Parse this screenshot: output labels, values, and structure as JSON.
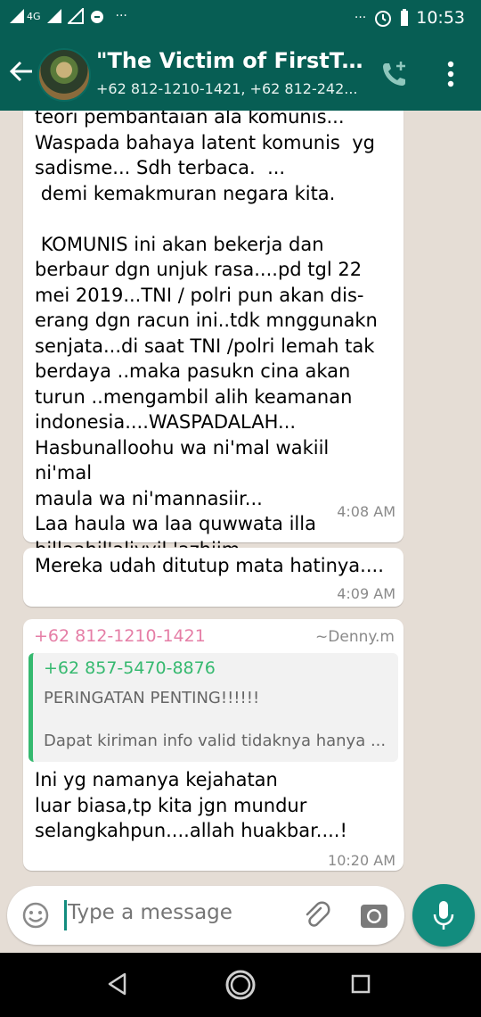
{
  "status_bar": {
    "time": "10:53",
    "more_left": "···",
    "more_right": "···",
    "network_label": "4G"
  },
  "header": {
    "title": "\"The Victim of FirstTrvel",
    "subtitle": "+62 812-1210-1421, +62 812-242..."
  },
  "messages": [
    {
      "text": "teori pembantaian ala komunis...\nWaspada bahaya latent komunis  yg\nsadisme... Sdh terbaca.  ...\n demi kemakmuran negara kita.\n\n KOMUNIS ini akan bekerja dan\nberbaur dgn unjuk rasa....pd tgl 22\nmei 2019...TNI / polri pun akan dis-\nerang dgn racun ini..tdk mnggunakn\nsenjata...di saat TNI /polri lemah tak\nberdaya ..maka pasukn cina akan\nturun ..mengambil alih keamanan\nindonesia....WASPADALAH...\nHasbunalloohu wa ni'mal wakiil ni'mal\nmaula wa ni'mannasiir...\nLaa haula wa laa quwwata illa\nbillaahil'aliyyil 'azhiim...",
      "time": "4:08 AM"
    },
    {
      "text": "Mereka udah ditutup mata hatinya....",
      "time": "4:09 AM"
    },
    {
      "sender": "+62 812-1210-1421",
      "push_name": "~Denny.m",
      "quote_author": "+62 857-5470-8876",
      "quote_line1": "PERINGATAN PENTING!!!!!!",
      "quote_line2": "Dapat kiriman info valid tidaknya hanya ...",
      "text": "Ini yg namanya kejahatan\nluar biasa,tp kita jgn mundur\nselangkahpun....allah huakbar....!",
      "time": "10:20 AM"
    }
  ],
  "input": {
    "placeholder": "Type a message"
  },
  "colors": {
    "header": "#075e54",
    "accent": "#128c7e",
    "sender_name": "#e57ea6",
    "quote_author": "#35b96f",
    "chat_background": "#e5ddd5"
  },
  "icons": [
    "back-arrow-icon",
    "add-call-icon",
    "more-vert-icon",
    "emoji-icon",
    "attach-icon",
    "camera-icon",
    "mic-icon",
    "nav-back-icon",
    "nav-home-icon",
    "nav-recents-icon"
  ]
}
